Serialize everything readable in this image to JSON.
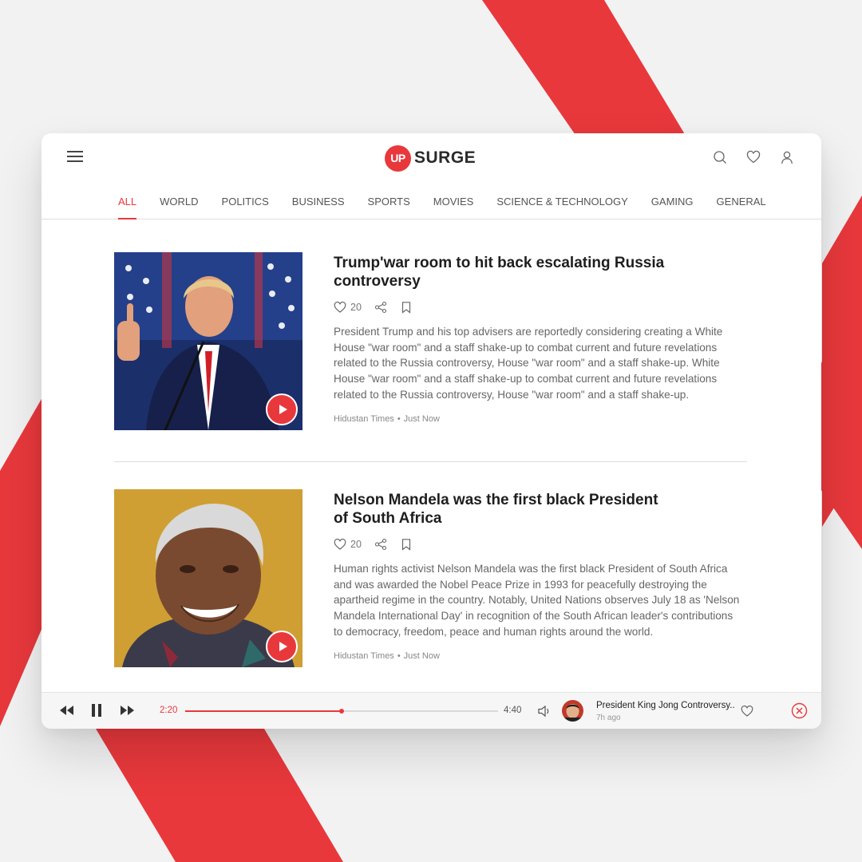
{
  "colors": {
    "accent": "#e8383c",
    "background": "#f2f2f3",
    "text": "#1e1e1e",
    "muted": "#666666"
  },
  "brand": {
    "logo_mark": "UP",
    "name": "SURGE"
  },
  "header": {
    "icons": [
      "menu-icon",
      "search-icon",
      "heart-icon",
      "user-icon"
    ]
  },
  "nav": {
    "tabs": [
      {
        "label": "ALL",
        "active": true
      },
      {
        "label": "WORLD"
      },
      {
        "label": "POLITICS"
      },
      {
        "label": "BUSINESS"
      },
      {
        "label": "SPORTS"
      },
      {
        "label": "MOVIES"
      },
      {
        "label": "SCIENCE & TECHNOLOGY"
      },
      {
        "label": "GAMING"
      },
      {
        "label": "GENERAL"
      }
    ]
  },
  "articles": [
    {
      "title": "Trump'war room to hit back escalating Russia controversy",
      "likes": "20",
      "body": "President Trump and his top advisers are reportedly considering creating a White House \"war room\" and a staff shake-up to combat current and future revelations related to the Russia controversy, House \"war room\" and a staff shake-up. White House \"war room\" and a staff shake-up to combat current and future revelations related to the Russia controversy, House \"war room\" and a staff shake-up.",
      "source": "Hidustan Times",
      "time": "Just Now"
    },
    {
      "title": "Nelson Mandela was the first black President of South Africa",
      "likes": "20",
      "body": "Human rights activist Nelson Mandela was the first black President of South Africa and was awarded the Nobel Peace Prize in 1993 for peacefully destroying the apartheid regime in the country. Notably, United Nations observes July 18 as 'Nelson Mandela International Day' in recognition of the South African leader's contributions to democracy, freedom, peace and human rights around the world.",
      "source": "Hidustan Times",
      "time": "Just Now"
    }
  ],
  "player": {
    "current_time": "2:20",
    "total_time": "4:40",
    "progress": 0.5,
    "now_playing_title": "President King Jong Controversy..",
    "now_playing_time": "7h ago"
  }
}
